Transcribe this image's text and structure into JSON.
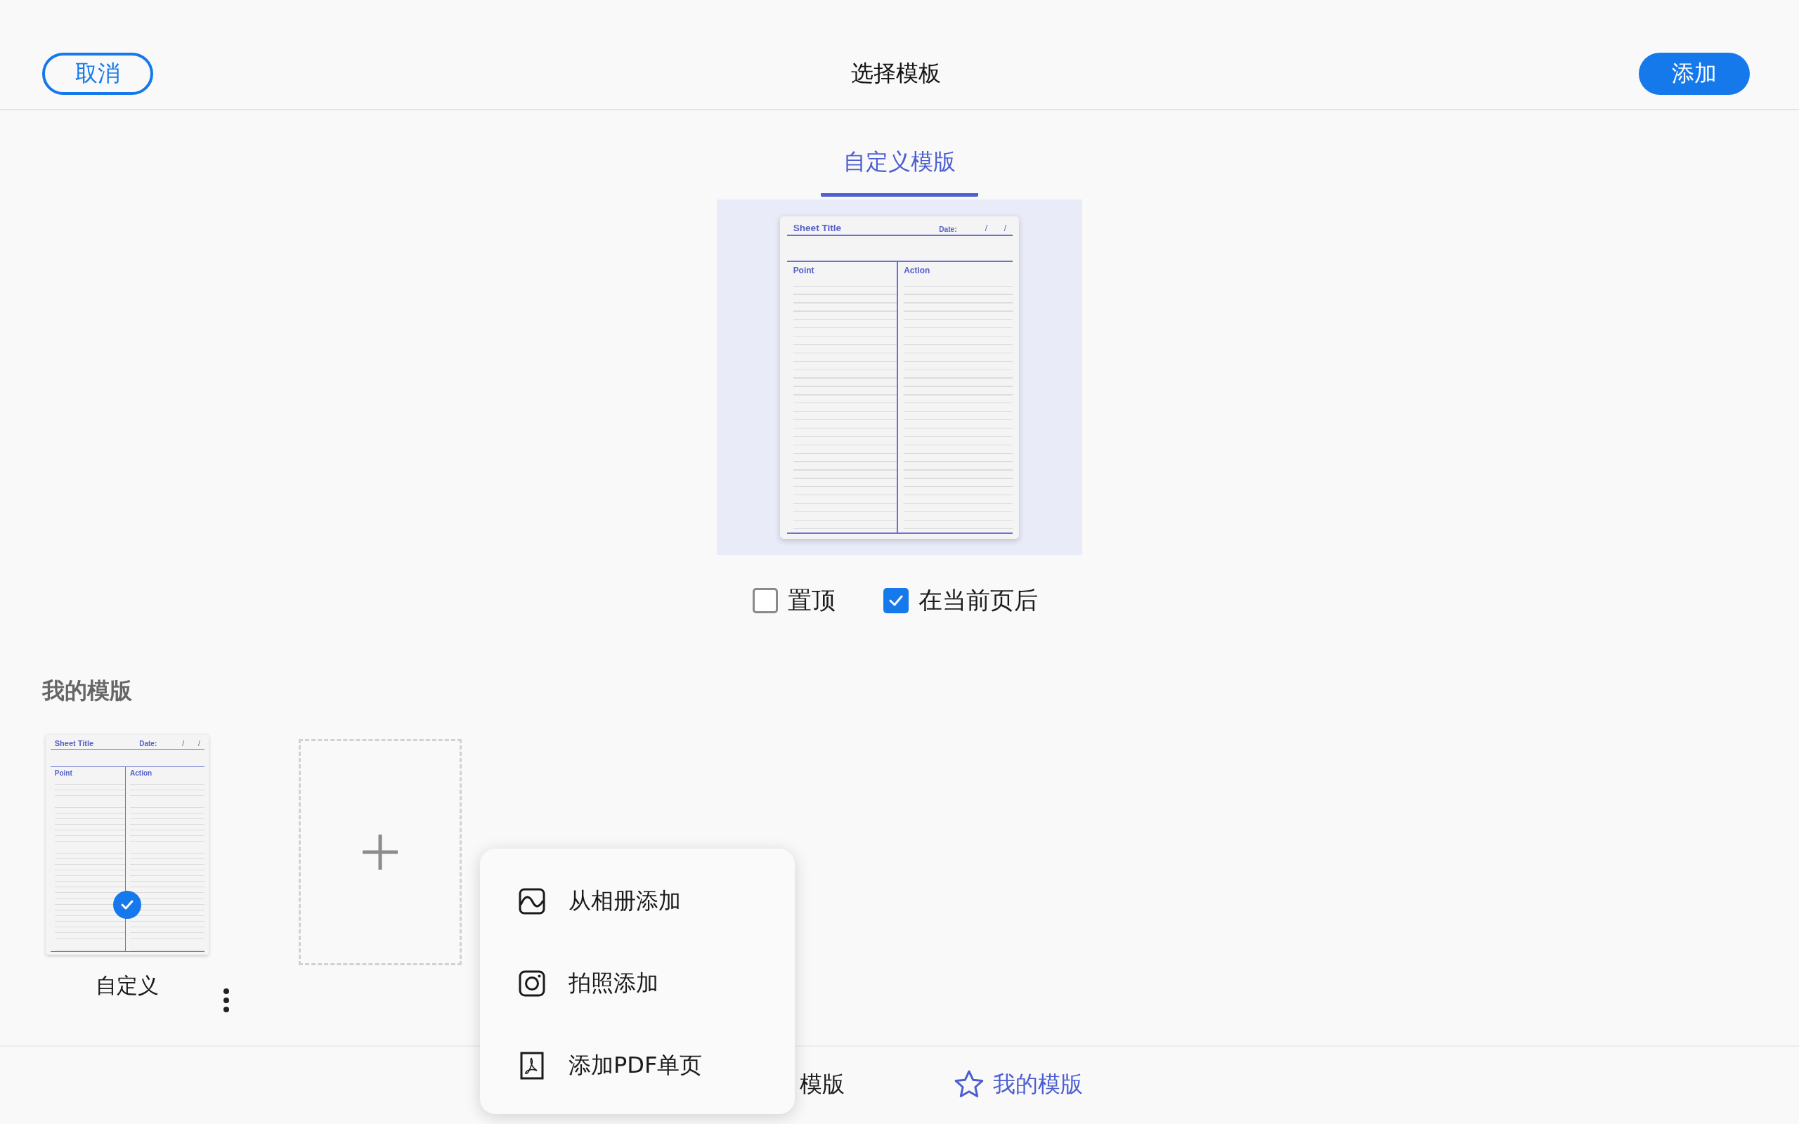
{
  "header": {
    "cancel": "取消",
    "title": "选择模板",
    "add": "添加"
  },
  "tabs": [
    {
      "label": "自定义模版",
      "selected": true
    }
  ],
  "preview": {
    "sheet_title": "Sheet Title",
    "date_label": "Date:",
    "date_separators": [
      "/",
      "/"
    ],
    "column_1": "Point",
    "column_2": "Action"
  },
  "options": [
    {
      "label": "置顶",
      "checked": false
    },
    {
      "label": "在当前页后",
      "checked": true
    }
  ],
  "my_templates": {
    "heading": "我的模版",
    "items": [
      {
        "name": "自定义",
        "selected": true,
        "sheet": {
          "sheet_title": "Sheet Title",
          "date_label": "Date:",
          "date_separators": [
            "/",
            "/"
          ],
          "column_1": "Point",
          "column_2": "Action"
        }
      }
    ]
  },
  "add_menu": [
    {
      "kind": "album",
      "label": "从相册添加"
    },
    {
      "kind": "camera",
      "label": "拍照添加"
    },
    {
      "kind": "pdf",
      "label": "添加PDF单页"
    }
  ],
  "bottom_tabs": [
    {
      "label": "模版",
      "selected": false
    },
    {
      "label": "我的模版",
      "selected": true
    }
  ]
}
